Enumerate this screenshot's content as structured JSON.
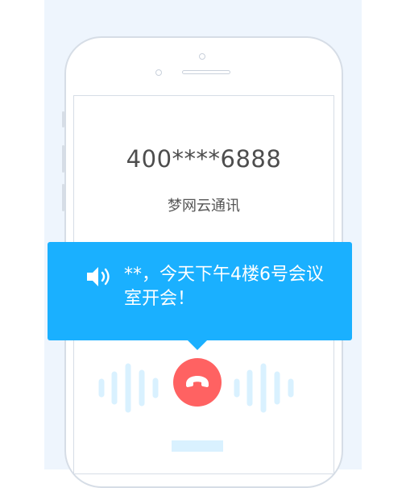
{
  "call": {
    "phone_number": "400****6888",
    "caller_name": "梦网云通讯",
    "message": "**，今天下午4楼6号会议室开会！"
  },
  "icons": {
    "speaker": "speaker-icon",
    "hangup": "phone-hangup-icon"
  },
  "colors": {
    "bubble": "#1ab0ff",
    "hangup": "#ff6262",
    "waveform": "#d9f1ff",
    "background": "#eef5fd"
  }
}
